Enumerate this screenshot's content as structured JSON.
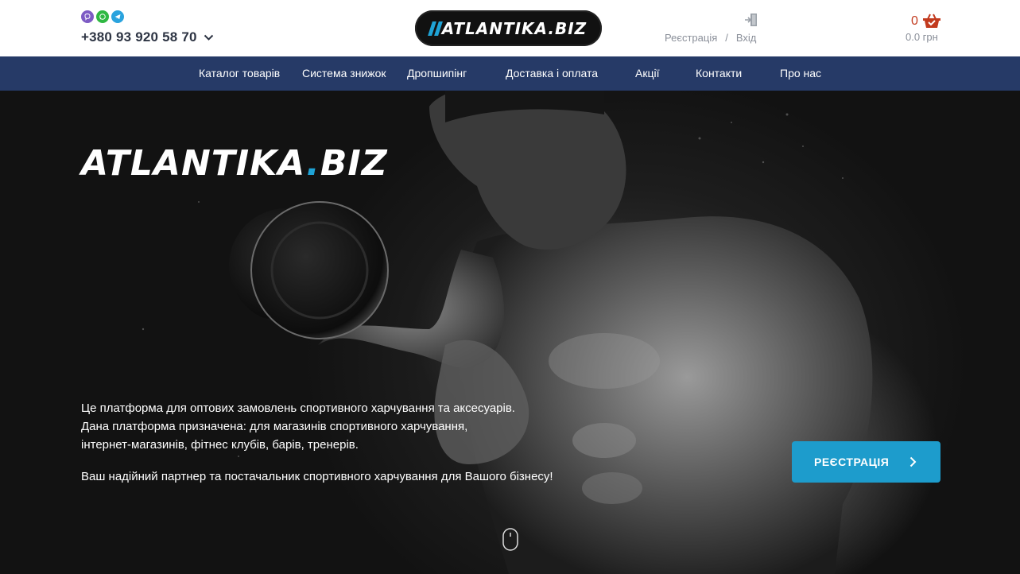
{
  "header": {
    "messengers": [
      {
        "name": "viber-icon",
        "color": "#7d5bc4"
      },
      {
        "name": "whatsapp-icon",
        "color": "#2fb842"
      },
      {
        "name": "telegram-icon",
        "color": "#2aa3de"
      }
    ],
    "phone": "+380 93 920 58 70",
    "logo": "ATLANTIKA.BIZ",
    "auth": {
      "register": "Реєстрація",
      "separator": "/",
      "login": "Вхід"
    },
    "cart": {
      "count": "0",
      "total": "0.0 грн"
    }
  },
  "nav": {
    "items": [
      {
        "label": "Каталог товарів"
      },
      {
        "label": "Система знижок"
      },
      {
        "label": "Дропшипінг"
      },
      {
        "label": "Доставка і оплата"
      },
      {
        "label": "Акції"
      },
      {
        "label": "Контакти"
      },
      {
        "label": "Про нас"
      }
    ]
  },
  "hero": {
    "logo_main": "ATLANTIKA",
    "logo_dot": ".",
    "logo_tld": "BIZ",
    "lines": [
      "Це платформа для оптових замовлень спортивного харчування та аксесуарів.",
      "Дана платформа призначена: для магазинів спортивного харчування,",
      "інтернет-магазинів, фітнес клубів, барів, тренерів."
    ],
    "tagline": "Ваш надійний партнер та постачальник спортивного харчування для Вашого бізнесу!",
    "cta": "РЕЄСТРАЦІЯ"
  },
  "colors": {
    "nav_bg": "#263a67",
    "accent": "#1d9ccc",
    "cart_red": "#c23a1e"
  }
}
